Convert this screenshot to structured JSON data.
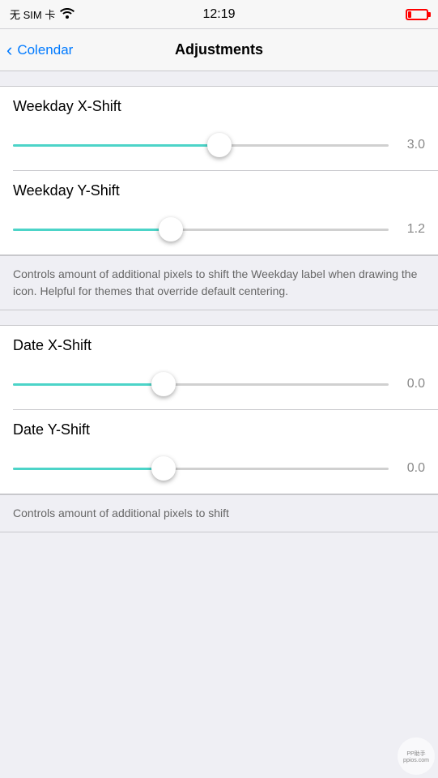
{
  "statusBar": {
    "carrier": "无 SIM 卡",
    "time": "12:19"
  },
  "navBar": {
    "backLabel": "Colendar",
    "title": "Adjustments"
  },
  "sections": [
    {
      "id": "weekday",
      "sliders": [
        {
          "label": "Weekday X-Shift",
          "value": "3.0",
          "fillPercent": 55,
          "thumbPercent": 55
        },
        {
          "label": "Weekday Y-Shift",
          "value": "1.2",
          "fillPercent": 42,
          "thumbPercent": 42
        }
      ],
      "description": "Controls amount of additional pixels to shift the Weekday label when drawing the icon. Helpful for themes that override default centering."
    },
    {
      "id": "date",
      "sliders": [
        {
          "label": "Date X-Shift",
          "value": "0.0",
          "fillPercent": 40,
          "thumbPercent": 40
        },
        {
          "label": "Date Y-Shift",
          "value": "0.0",
          "fillPercent": 40,
          "thumbPercent": 40
        }
      ],
      "description": "Controls amount of additional pixels to shift"
    }
  ],
  "watermark": {
    "line1": "PP助手",
    "line2": "ppios.com"
  }
}
